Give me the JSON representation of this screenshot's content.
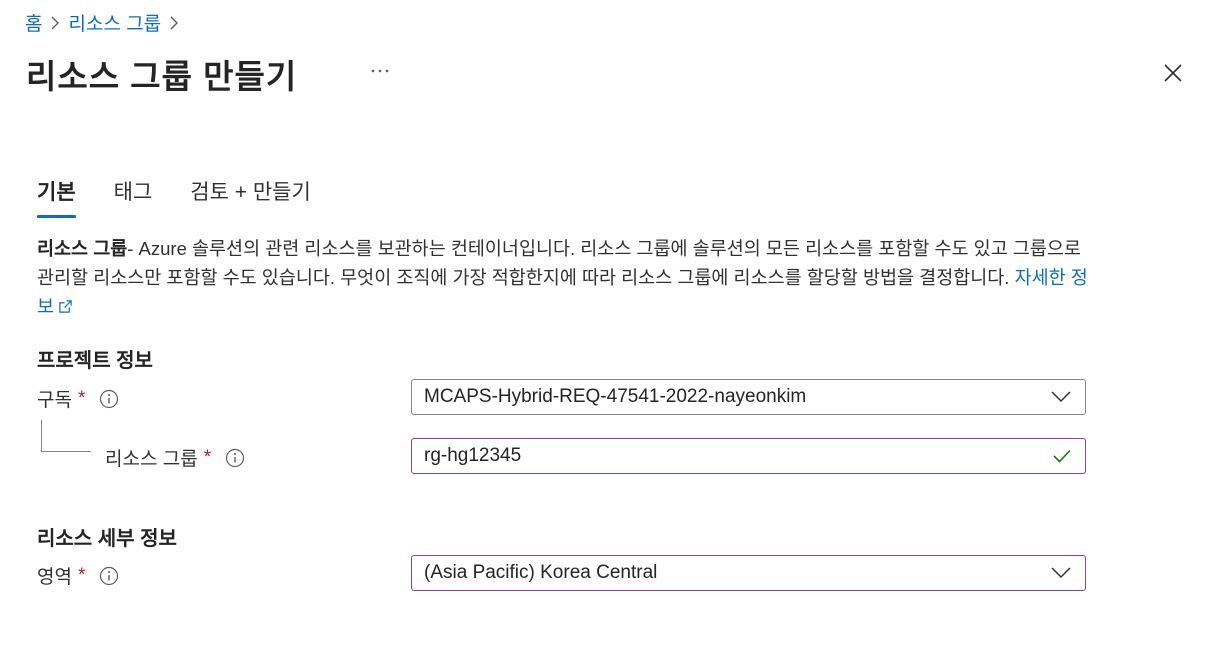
{
  "breadcrumb": {
    "items": [
      "홈",
      "리소스 그룹"
    ]
  },
  "page": {
    "title": "리소스 그룹 만들기"
  },
  "tabs": [
    {
      "label": "기본",
      "active": true
    },
    {
      "label": "태그",
      "active": false
    },
    {
      "label": "검토 + 만들기",
      "active": false
    }
  ],
  "description": {
    "bold": "리소스 그룹",
    "text": "- Azure 솔루션의 관련 리소스를 보관하는 컨테이너입니다. 리소스 그룹에 솔루션의 모든 리소스를 포함할 수도 있고 그룹으로 관리할 리소스만 포함할 수도 있습니다. 무엇이 조직에 가장 적합한지에 따라 리소스 그룹에 리소스를 할당할 방법을 결정합니다. ",
    "link": "자세한 정보"
  },
  "project_section": {
    "title": "프로젝트 정보",
    "subscription": {
      "label": "구독",
      "required": "*",
      "value": "MCAPS-Hybrid-REQ-47541-2022-nayeonkim"
    },
    "resource_group": {
      "label": "리소스 그룹",
      "required": "*",
      "value": "rg-hg12345"
    }
  },
  "details_section": {
    "title": "리소스 세부 정보",
    "region": {
      "label": "영역",
      "required": "*",
      "value": "(Asia Pacific) Korea Central"
    }
  },
  "colors": {
    "accent": "#0f6cbd",
    "required": "#a4262c",
    "valid": "#107c10",
    "focus_border": "#8a3ea8"
  }
}
